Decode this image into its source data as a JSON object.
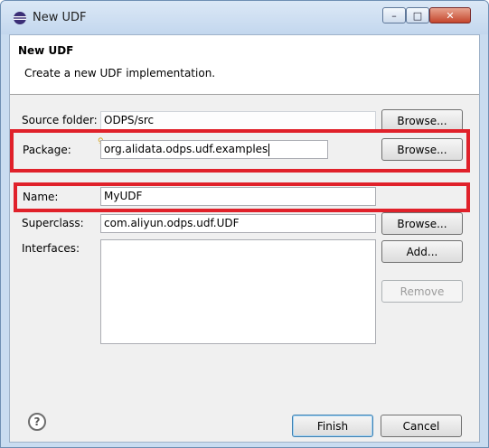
{
  "window": {
    "title": "New UDF",
    "min_symbol": "–",
    "max_symbol": "□",
    "close_symbol": "✕"
  },
  "header": {
    "title": "New UDF",
    "description": "Create a new UDF implementation."
  },
  "form": {
    "source_folder": {
      "label": "Source folder:",
      "value": "ODPS/src",
      "button": "Browse..."
    },
    "package": {
      "label": "Package:",
      "value": "org.alidata.odps.udf.examples",
      "button": "Browse..."
    },
    "name": {
      "label": "Name:",
      "value": "MyUDF"
    },
    "superclass": {
      "label": "Superclass:",
      "value": "com.aliyun.odps.udf.UDF",
      "button": "Browse..."
    },
    "interfaces": {
      "label": "Interfaces:",
      "add_button": "Add...",
      "remove_button": "Remove",
      "items": []
    }
  },
  "footer": {
    "help_symbol": "?",
    "finish": "Finish",
    "cancel": "Cancel"
  },
  "colors": {
    "highlight": "#e0212a",
    "title_bar": "#c3d7ee"
  }
}
